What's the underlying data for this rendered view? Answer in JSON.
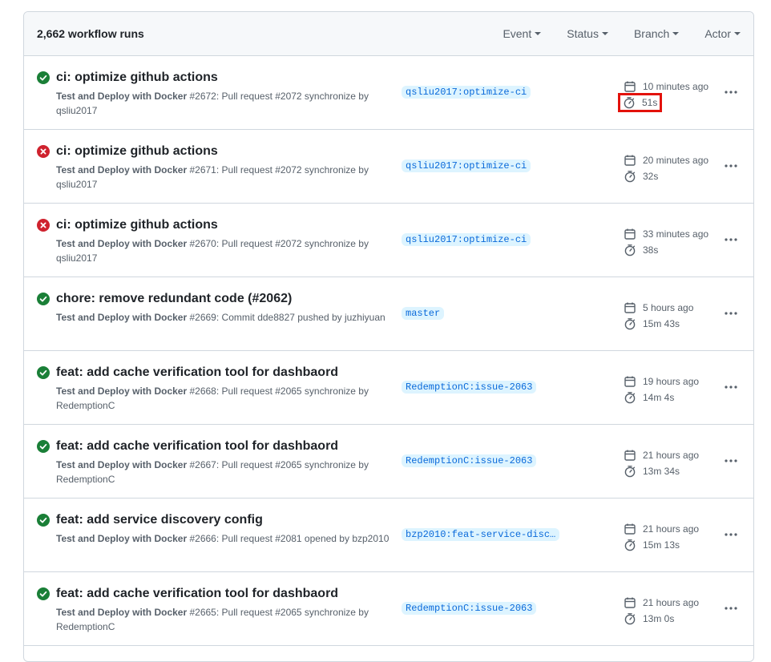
{
  "header": {
    "count_label": "2,662 workflow runs",
    "filters": [
      "Event",
      "Status",
      "Branch",
      "Actor"
    ]
  },
  "colors": {
    "success": "#1a7f37",
    "failure": "#cf222e",
    "branch_bg": "#ddf4ff",
    "branch_fg": "#0969da",
    "highlight": "#e3120b"
  },
  "runs": [
    {
      "status": "success",
      "title": "ci: optimize github actions",
      "workflow": "Test and Deploy with Docker",
      "detail": " #2672: Pull request #2072 synchronize by ",
      "actor": "qsliu2017",
      "branch": "qsliu2017:optimize-ci",
      "time": "10 minutes ago",
      "duration": "51s",
      "highlighted": true
    },
    {
      "status": "failure",
      "title": "ci: optimize github actions",
      "workflow": "Test and Deploy with Docker",
      "detail": " #2671: Pull request #2072 synchronize by ",
      "actor": "qsliu2017",
      "branch": "qsliu2017:optimize-ci",
      "time": "20 minutes ago",
      "duration": "32s",
      "highlighted": false
    },
    {
      "status": "failure",
      "title": "ci: optimize github actions",
      "workflow": "Test and Deploy with Docker",
      "detail": " #2670: Pull request #2072 synchronize by ",
      "actor": "qsliu2017",
      "branch": "qsliu2017:optimize-ci",
      "time": "33 minutes ago",
      "duration": "38s",
      "highlighted": false
    },
    {
      "status": "success",
      "title": "chore: remove redundant code (#2062)",
      "workflow": "Test and Deploy with Docker",
      "detail": " #2669: Commit dde8827 pushed by ",
      "actor": "juzhiyuan",
      "branch": "master",
      "time": "5 hours ago",
      "duration": "15m 43s",
      "highlighted": false
    },
    {
      "status": "success",
      "title": "feat: add cache verification tool for dashbaord",
      "workflow": "Test and Deploy with Docker",
      "detail": " #2668: Pull request #2065 synchronize by ",
      "actor": "RedemptionC",
      "branch": "RedemptionC:issue-2063",
      "time": "19 hours ago",
      "duration": "14m 4s",
      "highlighted": false
    },
    {
      "status": "success",
      "title": "feat: add cache verification tool for dashbaord",
      "workflow": "Test and Deploy with Docker",
      "detail": " #2667: Pull request #2065 synchronize by ",
      "actor": "RedemptionC",
      "branch": "RedemptionC:issue-2063",
      "time": "21 hours ago",
      "duration": "13m 34s",
      "highlighted": false
    },
    {
      "status": "success",
      "title": "feat: add service discovery config",
      "workflow": "Test and Deploy with Docker",
      "detail": " #2666: Pull request #2081 opened by ",
      "actor": "bzp2010",
      "branch": "bzp2010:feat-service-disc…",
      "time": "21 hours ago",
      "duration": "15m 13s",
      "highlighted": false
    },
    {
      "status": "success",
      "title": "feat: add cache verification tool for dashbaord",
      "workflow": "Test and Deploy with Docker",
      "detail": " #2665: Pull request #2065 synchronize by ",
      "actor": "RedemptionC",
      "branch": "RedemptionC:issue-2063",
      "time": "21 hours ago",
      "duration": "13m 0s",
      "highlighted": false
    }
  ]
}
